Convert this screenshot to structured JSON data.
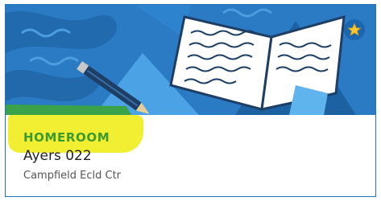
{
  "card": {
    "label": "HOMEROOM",
    "room": "Ayers 022",
    "school": "Campfield Ecld Ctr",
    "icons": {
      "banner": "book-pencil-illustration",
      "badge": "star-icon"
    }
  },
  "colors": {
    "banner_bg": "#2a7ac4",
    "label_text": "#3d9a2f",
    "highlight": "#f2ef32",
    "border": "#1f73b7",
    "star": "#f6c72d"
  }
}
